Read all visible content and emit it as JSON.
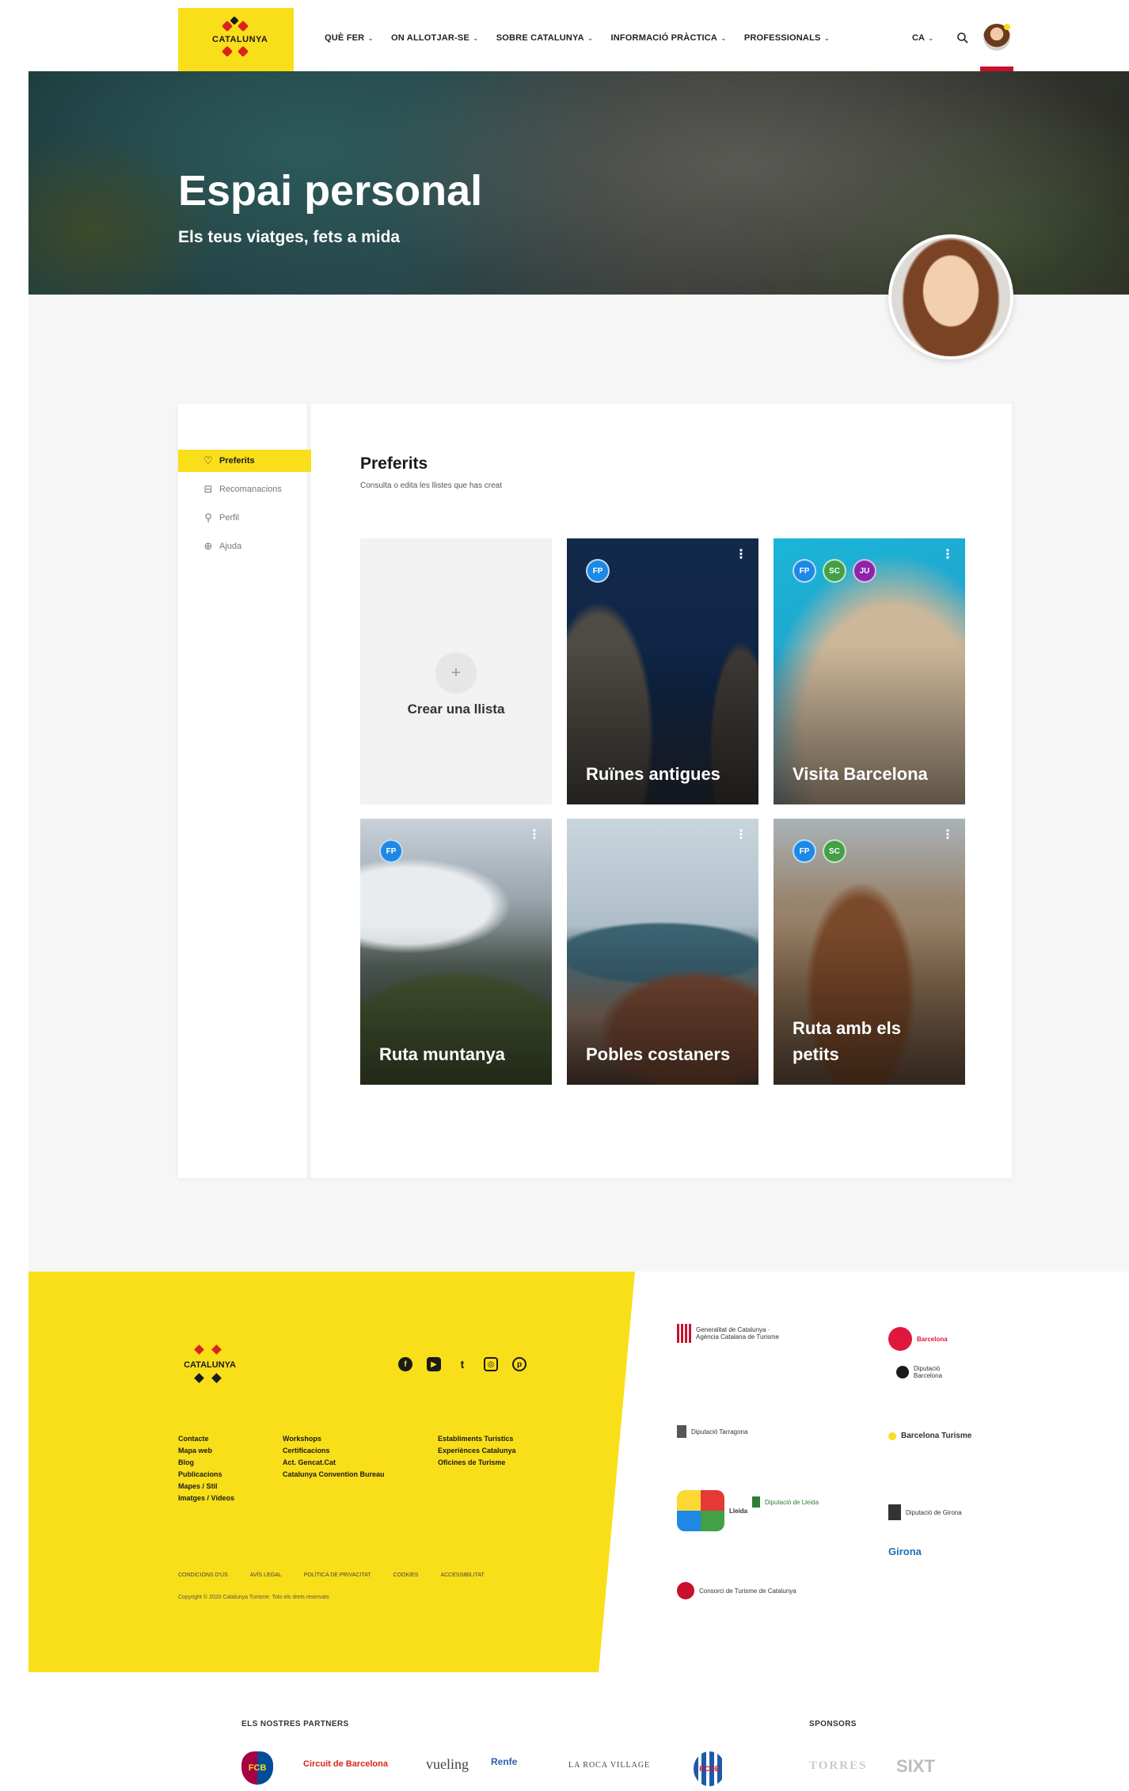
{
  "header": {
    "brand": "CATALUNYA",
    "nav": [
      {
        "label": "QUÈ FER"
      },
      {
        "label": "ON ALLOTJAR-SE"
      },
      {
        "label": "SOBRE CATALUNYA"
      },
      {
        "label": "INFORMACIÓ PRÀCTICA"
      },
      {
        "label": "PROFESSIONALS"
      }
    ],
    "language": "CA",
    "chevron": "⌄"
  },
  "hero": {
    "title": "Espai personal",
    "subtitle": "Els teus viatges, fets a mida"
  },
  "sidebar": {
    "items": [
      {
        "label": "Preferits",
        "icon": "heart-icon",
        "glyph": "♡",
        "active": true
      },
      {
        "label": "Recomanacions",
        "icon": "bookmark-icon",
        "glyph": "⊟",
        "active": false
      },
      {
        "label": "Perfil",
        "icon": "user-icon",
        "glyph": "⚲",
        "active": false
      },
      {
        "label": "Ajuda",
        "icon": "globe-icon",
        "glyph": "⊕",
        "active": false
      }
    ]
  },
  "favorites": {
    "title": "Preferits",
    "subtitle": "Consulta o edita les llistes que has creat",
    "create_label": "Crear una llista",
    "create_glyph": "+",
    "menu_glyph": "⋮",
    "lists": [
      {
        "title": "Ruïnes antigues",
        "avatars": [
          {
            "initials": "FP",
            "color": "#1e88e5"
          }
        ]
      },
      {
        "title": "Visita Barcelona",
        "avatars": [
          {
            "initials": "FP",
            "color": "#1e88e5"
          },
          {
            "initials": "SC",
            "color": "#43a047"
          },
          {
            "initials": "JU",
            "color": "#8e24aa"
          }
        ]
      },
      {
        "title": "Ruta muntanya",
        "avatars": [
          {
            "initials": "FP",
            "color": "#1e88e5"
          }
        ]
      },
      {
        "title": "Pobles costaners",
        "avatars": []
      },
      {
        "title": "Ruta amb els petits",
        "avatars": [
          {
            "initials": "FP",
            "color": "#1e88e5"
          },
          {
            "initials": "SC",
            "color": "#43a047"
          }
        ]
      }
    ]
  },
  "footer": {
    "brand": "CATALUNYA",
    "socials": [
      {
        "icon": "facebook-icon",
        "glyph": "f"
      },
      {
        "icon": "youtube-icon",
        "glyph": "▶"
      },
      {
        "icon": "twitter-icon",
        "glyph": "t"
      },
      {
        "icon": "instagram-icon",
        "glyph": "◎"
      },
      {
        "icon": "pinterest-icon",
        "glyph": "p"
      }
    ],
    "col1": [
      "Contacte",
      "Mapa web",
      "Blog",
      "Publicacions",
      "Mapes / Stil",
      "Imatges / Vídeos"
    ],
    "col2": [
      "Workshops",
      "Certificacions",
      "Act. Gencat.Cat",
      "Catalunya Convention Bureau"
    ],
    "col3": [
      "Establiments Turístics",
      "Experiènces Catalunya",
      "Oficines de Turisme"
    ],
    "legal": [
      "CONDICIONS D'ÚS",
      "AVÍS LEGAL",
      "POLÍTICA DE PRIVACITAT",
      "COOKIES",
      "ACCESSIBILITAT"
    ],
    "copyright": "Copyright © 2020 Catalunya Turisme. Tots els drets reservats",
    "institutions": [
      {
        "name": "Generalitat de Catalunya · Agència Catalana de Turisme"
      },
      {
        "name": "Barcelona"
      },
      {
        "name": "Diputació Barcelona"
      },
      {
        "name": "Diputació Tarragona"
      },
      {
        "name": "Barcelona Turisme"
      },
      {
        "name": "Lleida"
      },
      {
        "name": "Diputació de Lleida"
      },
      {
        "name": "Diputació de Girona"
      },
      {
        "name": "Girona"
      },
      {
        "name": "Consorci de Turisme de Catalunya"
      }
    ],
    "partners_label": "ELS NOSTRES PARTNERS",
    "sponsors_label": "SPONSORS",
    "partners": [
      "FCB",
      "Circuit de Barcelona",
      "vueling",
      "Renfe",
      "LA ROCA VILLAGE",
      "RCDE"
    ],
    "sponsors": [
      "TORRES",
      "SIXT"
    ]
  },
  "colors": {
    "accent": "#f9de1a",
    "brand_red": "#d9241b",
    "active_red": "#c8102e"
  }
}
